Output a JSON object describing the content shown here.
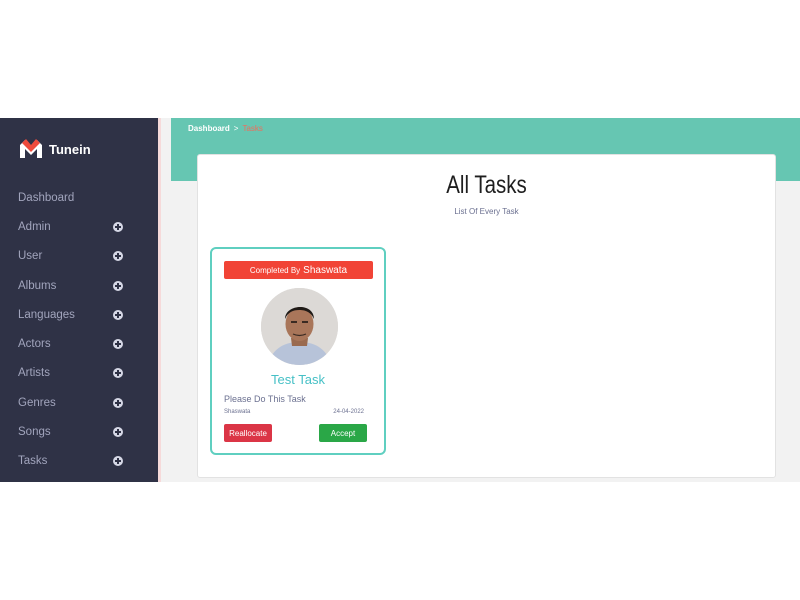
{
  "sidebar": {
    "brand": "Tunein",
    "items": [
      {
        "label": "Dashboard",
        "expandable": false
      },
      {
        "label": "Admin",
        "expandable": true
      },
      {
        "label": "User",
        "expandable": true
      },
      {
        "label": "Albums",
        "expandable": true
      },
      {
        "label": "Languages",
        "expandable": true
      },
      {
        "label": "Actors",
        "expandable": true
      },
      {
        "label": "Artists",
        "expandable": true
      },
      {
        "label": "Genres",
        "expandable": true
      },
      {
        "label": "Songs",
        "expandable": true
      },
      {
        "label": "Tasks",
        "expandable": true
      }
    ]
  },
  "breadcrumb": {
    "home": "Dashboard",
    "separator": ">",
    "current": "Tasks"
  },
  "page": {
    "title": "All Tasks",
    "subtitle": "List Of Every Task"
  },
  "task": {
    "status_prefix": "Completed By",
    "status_name": "Shaswata",
    "title": "Test Task",
    "description": "Please Do This Task",
    "assignee": "Shaswata",
    "date": "24-04-2022",
    "reallocate_label": "Reallocate",
    "accept_label": "Accept"
  },
  "colors": {
    "sidebar_bg": "#2f3246",
    "topband": "#66c6b2",
    "status_red": "#f14436",
    "card_border": "#5fcfc0",
    "reallocate": "#db3546",
    "accept": "#2aa747"
  }
}
